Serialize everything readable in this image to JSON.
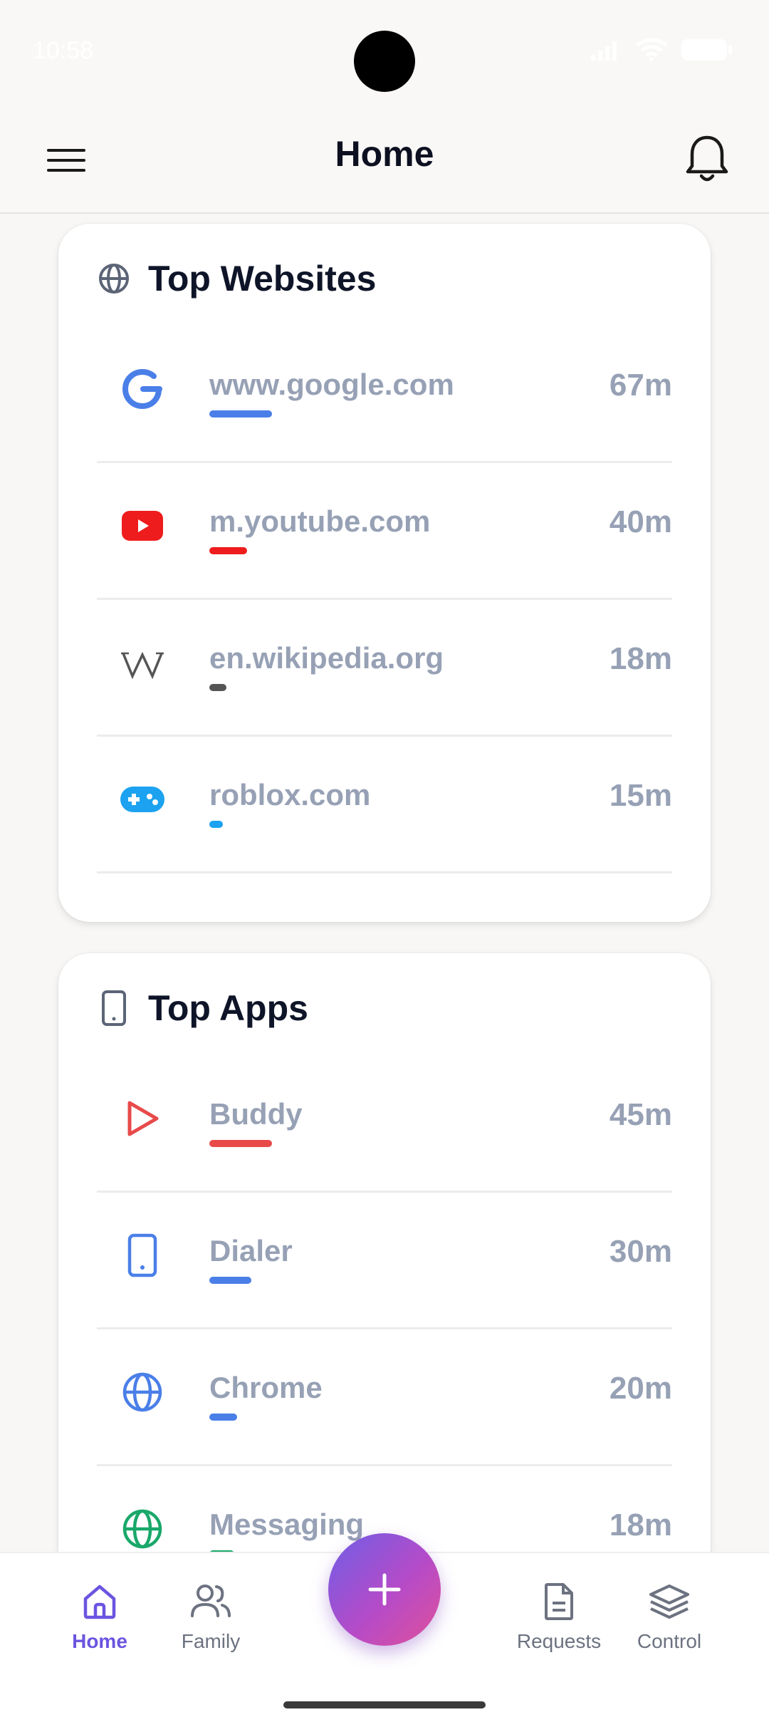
{
  "status_bar": {
    "time": "10:58"
  },
  "header": {
    "title": "Home",
    "menu_icon": "hamburger-menu-icon",
    "notification_icon": "bell-icon"
  },
  "top_websites": {
    "title": "Top Websites",
    "icon": "globe-icon",
    "items": [
      {
        "name": "www.google.com",
        "time": "67m",
        "icon": "google-icon",
        "color": "#4a7fe8",
        "fraction": 1.0
      },
      {
        "name": "m.youtube.com",
        "time": "40m",
        "icon": "youtube-icon",
        "color": "#ee1c1c",
        "fraction": 0.6
      },
      {
        "name": "en.wikipedia.org",
        "time": "18m",
        "icon": "wikipedia-icon",
        "color": "#555555",
        "fraction": 0.27
      },
      {
        "name": "roblox.com",
        "time": "15m",
        "icon": "gamepad-icon",
        "color": "#1ca2f0",
        "fraction": 0.22
      }
    ]
  },
  "top_apps": {
    "title": "Top Apps",
    "icon": "phone-icon",
    "items": [
      {
        "name": "Buddy",
        "time": "45m",
        "icon": "play-icon",
        "color": "#e84a4a",
        "fraction": 1.0
      },
      {
        "name": "Dialer",
        "time": "30m",
        "icon": "phone-icon",
        "color": "#4a7fe8",
        "fraction": 0.67
      },
      {
        "name": "Chrome",
        "time": "20m",
        "icon": "globe-icon",
        "color": "#4a7fe8",
        "fraction": 0.44
      },
      {
        "name": "Messaging",
        "time": "18m",
        "icon": "globe-icon",
        "color": "#1aa86a",
        "fraction": 0.4
      }
    ]
  },
  "bottom_nav": {
    "home": "Home",
    "family": "Family",
    "requests": "Requests",
    "control": "Control",
    "fab_icon": "plus-icon",
    "active": "Home",
    "accent": "#6a55e0"
  }
}
